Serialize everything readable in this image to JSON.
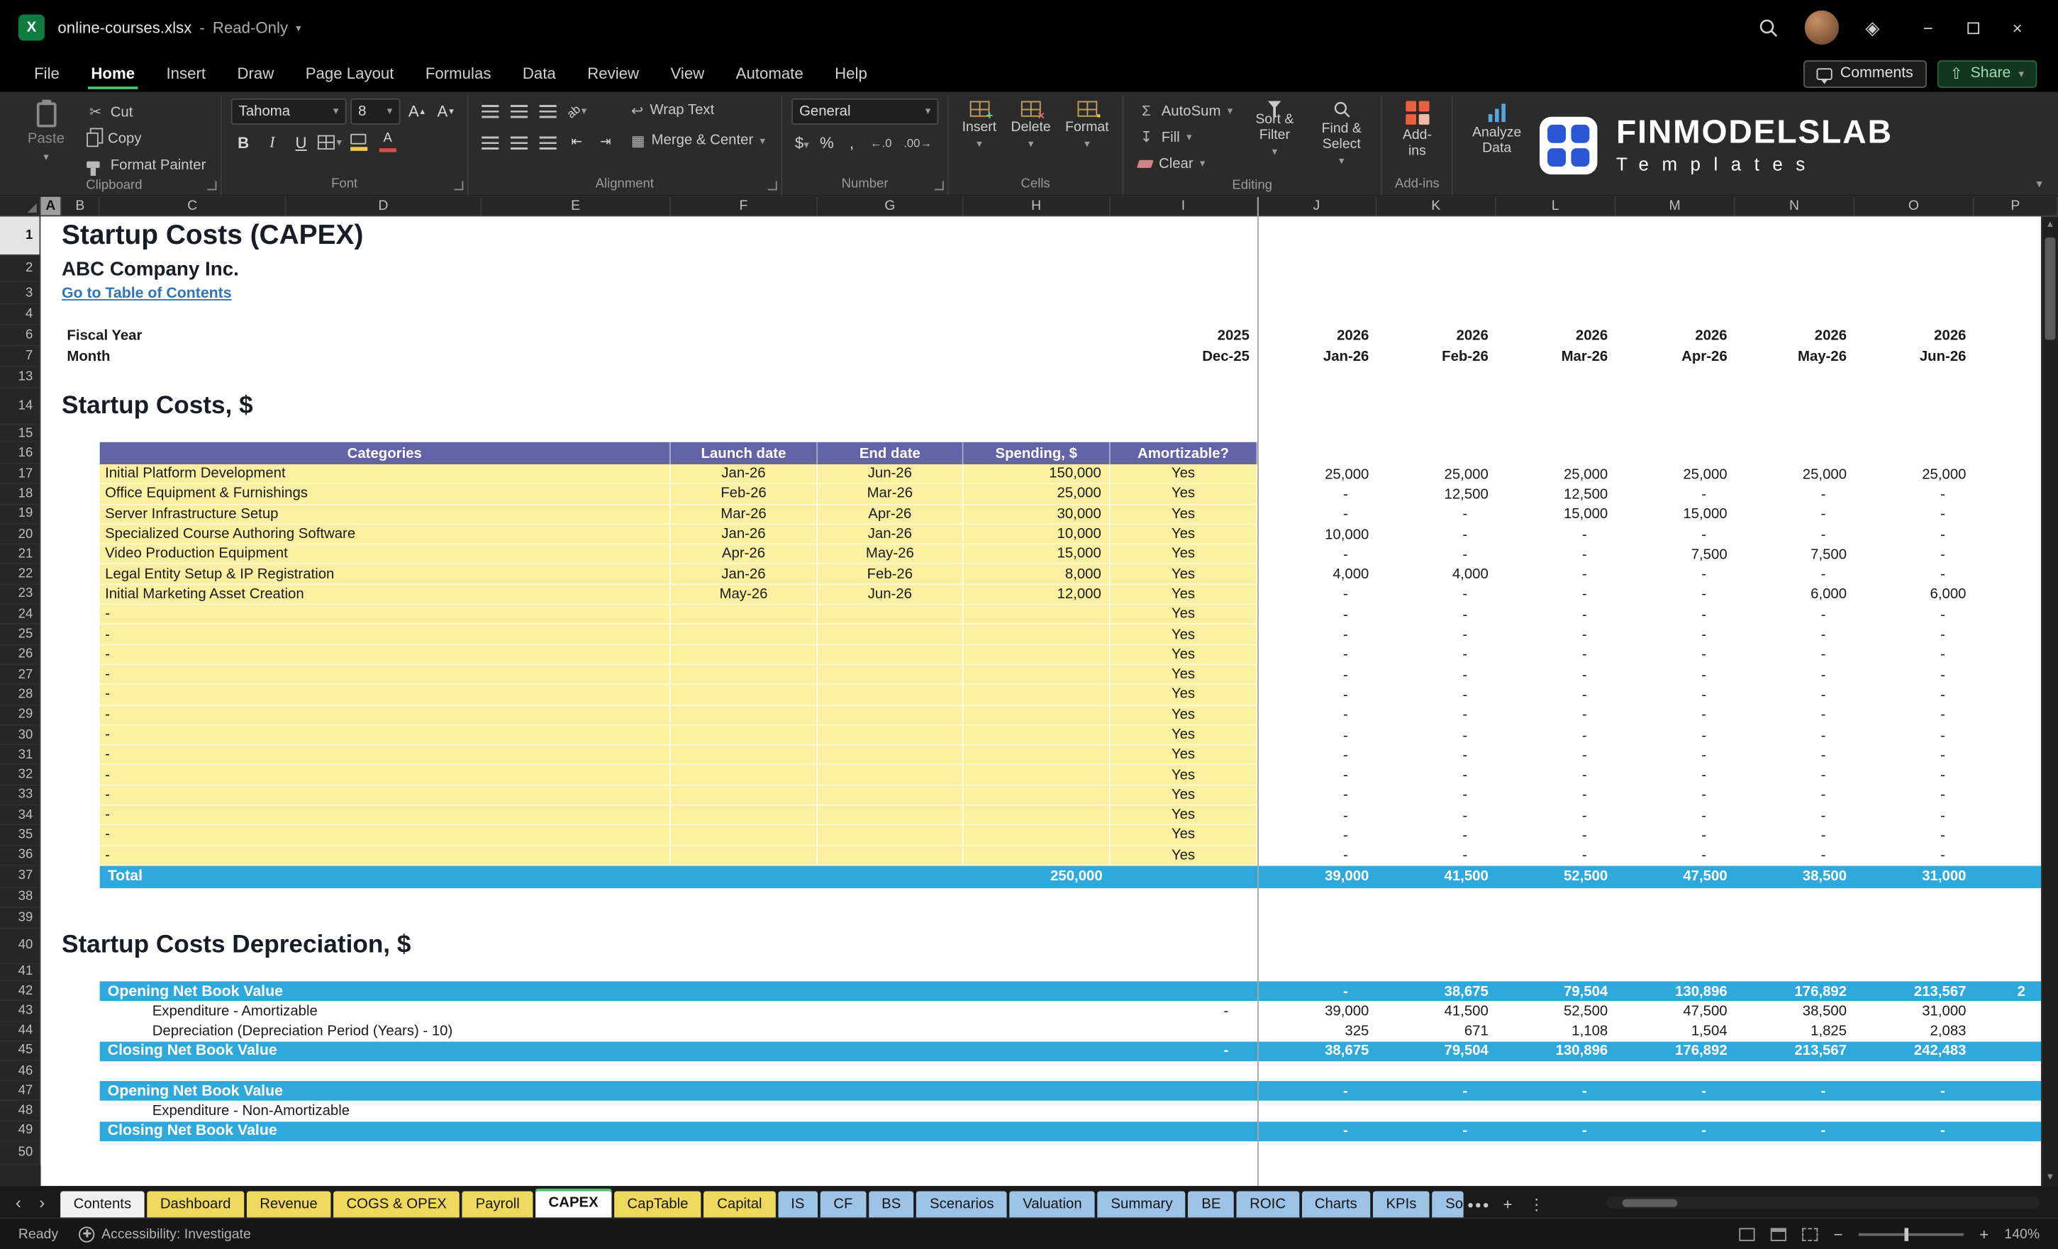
{
  "colors": {
    "accent_green": "#4CC273",
    "table_header": "#6264A7",
    "table_row_yellow": "#FBF0A0",
    "band_blue": "#2FA9DC",
    "link_blue": "#2E75B6",
    "tab_yellow": "#EFD95E",
    "tab_blue": "#9DC3E6"
  },
  "titlebar": {
    "filename": "online-courses.xlsx",
    "separator": "-",
    "mode": "Read-Only"
  },
  "menubar": {
    "items": [
      "File",
      "Home",
      "Insert",
      "Draw",
      "Page Layout",
      "Formulas",
      "Data",
      "Review",
      "View",
      "Automate",
      "Help"
    ],
    "active_item": "Home",
    "comments_label": "Comments",
    "share_label": "Share"
  },
  "ribbon": {
    "paste": "Paste",
    "cut": "Cut",
    "copy": "Copy",
    "format_painter": "Format Painter",
    "clipboard_group": "Clipboard",
    "font_name": "Tahoma",
    "font_size": "8",
    "font_group": "Font",
    "wrap_text": "Wrap Text",
    "merge_center": "Merge & Center",
    "alignment_group": "Alignment",
    "number_format": "General",
    "number_group": "Number",
    "insert": "Insert",
    "delete": "Delete",
    "format": "Format",
    "cells_group": "Cells",
    "autosum": "AutoSum",
    "fill": "Fill",
    "clear": "Clear",
    "sort_filter": "Sort & Filter",
    "find_select": "Find & Select",
    "editing_group": "Editing",
    "addins": "Add-ins",
    "addins_group": "Add-ins",
    "analyze_data": "Analyze Data",
    "logo_name": "FINMODELSLAB",
    "logo_tagline": "Templates"
  },
  "grid": {
    "columns": [
      "A",
      "B",
      "C",
      "D",
      "E",
      "F",
      "G",
      "H",
      "I",
      "J",
      "K",
      "L",
      "M",
      "N",
      "O",
      "P"
    ],
    "rows": [
      1,
      2,
      3,
      4,
      6,
      7,
      13,
      14,
      15,
      16,
      17,
      18,
      19,
      20,
      21,
      22,
      23,
      24,
      25,
      26,
      27,
      28,
      29,
      30,
      31,
      32,
      33,
      34,
      35,
      36,
      37,
      38,
      39,
      40,
      41,
      42,
      43,
      44,
      45,
      46,
      47,
      48,
      49,
      50
    ],
    "active_cell_column": "A",
    "active_cell_row": 1
  },
  "sheet": {
    "title": "Startup Costs (CAPEX)",
    "company": "ABC Company Inc.",
    "toc_link": "Go to Table of Contents",
    "fiscal_year_label": "Fiscal Year",
    "month_label": "Month",
    "fiscal_years": [
      "2025",
      "2026",
      "2026",
      "2026",
      "2026",
      "2026",
      "2026"
    ],
    "months": [
      "Dec-25",
      "Jan-26",
      "Feb-26",
      "Mar-26",
      "Apr-26",
      "May-26",
      "Jun-26"
    ],
    "section_costs": "Startup Costs, $",
    "table": {
      "headers": [
        "Categories",
        "Launch date",
        "End date",
        "Spending, $",
        "Amortizable?"
      ],
      "rows": [
        {
          "category": "Initial Platform Development",
          "launch": "Jan-26",
          "end": "Jun-26",
          "spending": "150,000",
          "amortizable": "Yes",
          "values": [
            "25,000",
            "25,000",
            "25,000",
            "25,000",
            "25,000",
            "25,000"
          ]
        },
        {
          "category": "Office Equipment & Furnishings",
          "launch": "Feb-26",
          "end": "Mar-26",
          "spending": "25,000",
          "amortizable": "Yes",
          "values": [
            "-",
            "12,500",
            "12,500",
            "-",
            "-",
            "-"
          ]
        },
        {
          "category": "Server Infrastructure Setup",
          "launch": "Mar-26",
          "end": "Apr-26",
          "spending": "30,000",
          "amortizable": "Yes",
          "values": [
            "-",
            "-",
            "15,000",
            "15,000",
            "-",
            "-"
          ]
        },
        {
          "category": "Specialized Course Authoring Software",
          "launch": "Jan-26",
          "end": "Jan-26",
          "spending": "10,000",
          "amortizable": "Yes",
          "values": [
            "10,000",
            "-",
            "-",
            "-",
            "-",
            "-"
          ]
        },
        {
          "category": "Video Production Equipment",
          "launch": "Apr-26",
          "end": "May-26",
          "spending": "15,000",
          "amortizable": "Yes",
          "values": [
            "-",
            "-",
            "-",
            "7,500",
            "7,500",
            "-"
          ]
        },
        {
          "category": "Legal Entity Setup & IP Registration",
          "launch": "Jan-26",
          "end": "Feb-26",
          "spending": "8,000",
          "amortizable": "Yes",
          "values": [
            "4,000",
            "4,000",
            "-",
            "-",
            "-",
            "-"
          ]
        },
        {
          "category": "Initial Marketing Asset Creation",
          "launch": "May-26",
          "end": "Jun-26",
          "spending": "12,000",
          "amortizable": "Yes",
          "values": [
            "-",
            "-",
            "-",
            "-",
            "6,000",
            "6,000"
          ]
        },
        {
          "category": "-",
          "launch": "",
          "end": "",
          "spending": "",
          "amortizable": "Yes",
          "values": [
            "-",
            "-",
            "-",
            "-",
            "-",
            "-"
          ]
        },
        {
          "category": "-",
          "launch": "",
          "end": "",
          "spending": "",
          "amortizable": "Yes",
          "values": [
            "-",
            "-",
            "-",
            "-",
            "-",
            "-"
          ]
        },
        {
          "category": "-",
          "launch": "",
          "end": "",
          "spending": "",
          "amortizable": "Yes",
          "values": [
            "-",
            "-",
            "-",
            "-",
            "-",
            "-"
          ]
        },
        {
          "category": "-",
          "launch": "",
          "end": "",
          "spending": "",
          "amortizable": "Yes",
          "values": [
            "-",
            "-",
            "-",
            "-",
            "-",
            "-"
          ]
        },
        {
          "category": "-",
          "launch": "",
          "end": "",
          "spending": "",
          "amortizable": "Yes",
          "values": [
            "-",
            "-",
            "-",
            "-",
            "-",
            "-"
          ]
        },
        {
          "category": "-",
          "launch": "",
          "end": "",
          "spending": "",
          "amortizable": "Yes",
          "values": [
            "-",
            "-",
            "-",
            "-",
            "-",
            "-"
          ]
        },
        {
          "category": "-",
          "launch": "",
          "end": "",
          "spending": "",
          "amortizable": "Yes",
          "values": [
            "-",
            "-",
            "-",
            "-",
            "-",
            "-"
          ]
        },
        {
          "category": "-",
          "launch": "",
          "end": "",
          "spending": "",
          "amortizable": "Yes",
          "values": [
            "-",
            "-",
            "-",
            "-",
            "-",
            "-"
          ]
        },
        {
          "category": "-",
          "launch": "",
          "end": "",
          "spending": "",
          "amortizable": "Yes",
          "values": [
            "-",
            "-",
            "-",
            "-",
            "-",
            "-"
          ]
        },
        {
          "category": "-",
          "launch": "",
          "end": "",
          "spending": "",
          "amortizable": "Yes",
          "values": [
            "-",
            "-",
            "-",
            "-",
            "-",
            "-"
          ]
        },
        {
          "category": "-",
          "launch": "",
          "end": "",
          "spending": "",
          "amortizable": "Yes",
          "values": [
            "-",
            "-",
            "-",
            "-",
            "-",
            "-"
          ]
        },
        {
          "category": "-",
          "launch": "",
          "end": "",
          "spending": "",
          "amortizable": "Yes",
          "values": [
            "-",
            "-",
            "-",
            "-",
            "-",
            "-"
          ]
        },
        {
          "category": "-",
          "launch": "",
          "end": "",
          "spending": "",
          "amortizable": "Yes",
          "values": [
            "-",
            "-",
            "-",
            "-",
            "-",
            "-"
          ]
        }
      ]
    },
    "total": {
      "label": "Total",
      "spending": "250,000",
      "values": [
        "39,000",
        "41,500",
        "52,500",
        "47,500",
        "38,500",
        "31,000"
      ]
    },
    "section_depreciation": "Startup Costs Depreciation, $",
    "depreciation": {
      "opening_label": "Opening Net Book Value",
      "closing_label": "Closing Net Book Value",
      "non_amortizable_label": "Expenditure - Non-Amortizable",
      "amortizable": {
        "label": "Expenditure - Amortizable",
        "dec": "-",
        "values": [
          "39,000",
          "41,500",
          "52,500",
          "47,500",
          "38,500",
          "31,000"
        ]
      },
      "period": {
        "label": "Depreciation (Depreciation Period (Years) - 10)",
        "values": [
          "325",
          "671",
          "1,108",
          "1,504",
          "1,825",
          "2,083"
        ]
      },
      "opening1": {
        "values": [
          "-",
          "38,675",
          "79,504",
          "130,896",
          "176,892",
          "213,567"
        ],
        "partial_next": "2"
      },
      "closing1": {
        "dec": "-",
        "values": [
          "38,675",
          "79,504",
          "130,896",
          "176,892",
          "213,567",
          "242,483"
        ]
      },
      "opening2": {
        "values": [
          "-",
          "-",
          "-",
          "-",
          "-",
          "-"
        ]
      },
      "closing2": {
        "values": [
          "-",
          "-",
          "-",
          "-",
          "-",
          "-"
        ]
      }
    }
  },
  "tabs": {
    "items": [
      {
        "label": "Contents",
        "color": "white"
      },
      {
        "label": "Dashboard",
        "color": "yellow"
      },
      {
        "label": "Revenue",
        "color": "yellow"
      },
      {
        "label": "COGS & OPEX",
        "color": "yellow"
      },
      {
        "label": "Payroll",
        "color": "yellow"
      },
      {
        "label": "CAPEX",
        "color": "white",
        "active": true
      },
      {
        "label": "CapTable",
        "color": "yellow"
      },
      {
        "label": "Capital",
        "color": "yellow"
      },
      {
        "label": "IS",
        "color": "blue"
      },
      {
        "label": "CF",
        "color": "blue"
      },
      {
        "label": "BS",
        "color": "blue"
      },
      {
        "label": "Scenarios",
        "color": "blue"
      },
      {
        "label": "Valuation",
        "color": "blue"
      },
      {
        "label": "Summary",
        "color": "blue"
      },
      {
        "label": "BE",
        "color": "blue"
      },
      {
        "label": "ROIC",
        "color": "blue"
      },
      {
        "label": "Charts",
        "color": "blue"
      },
      {
        "label": "KPIs",
        "color": "blue"
      },
      {
        "label": "So",
        "color": "blue",
        "clipped": true
      }
    ]
  },
  "statusbar": {
    "ready": "Ready",
    "accessibility": "Accessibility: Investigate",
    "zoom": "140%"
  }
}
